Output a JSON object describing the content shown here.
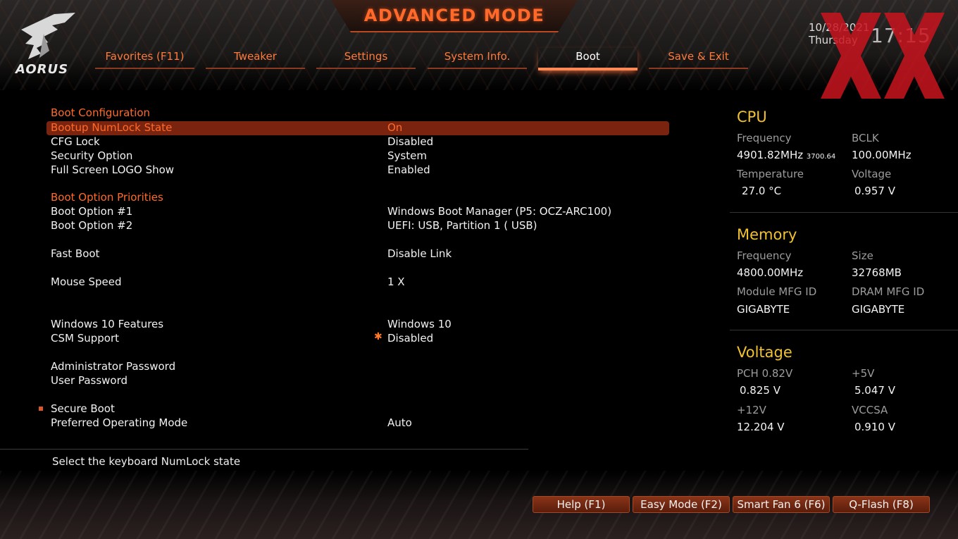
{
  "header": {
    "title": "ADVANCED MODE",
    "logo_text": "AORUS",
    "date": "10/28/2021",
    "weekday": "Thursday",
    "time": "17:15"
  },
  "tabs": [
    {
      "label": "Favorites (F11)",
      "active": false
    },
    {
      "label": "Tweaker",
      "active": false
    },
    {
      "label": "Settings",
      "active": false
    },
    {
      "label": "System Info.",
      "active": false
    },
    {
      "label": "Boot",
      "active": true
    },
    {
      "label": "Save & Exit",
      "active": false
    }
  ],
  "settings": {
    "boot_config_header": "Boot Configuration",
    "numlock": {
      "label": "Bootup NumLock State",
      "value": "On"
    },
    "cfg_lock": {
      "label": "CFG Lock",
      "value": "Disabled"
    },
    "security_option": {
      "label": "Security Option",
      "value": "System"
    },
    "logo_show": {
      "label": "Full Screen LOGO Show",
      "value": "Enabled"
    },
    "priorities_header": "Boot Option Priorities",
    "boot_option_1": {
      "label": "Boot Option #1",
      "value": "Windows Boot Manager (P5: OCZ-ARC100)"
    },
    "boot_option_2": {
      "label": "Boot Option #2",
      "value": "UEFI:  USB, Partition 1 ( USB)"
    },
    "fast_boot": {
      "label": "Fast Boot",
      "value": "Disable Link"
    },
    "mouse_speed": {
      "label": "Mouse Speed",
      "value": "1 X"
    },
    "win10_features": {
      "label": "Windows 10 Features",
      "value": "Windows 10"
    },
    "csm_support": {
      "label": "CSM Support",
      "value": "Disabled"
    },
    "admin_password": {
      "label": "Administrator Password"
    },
    "user_password": {
      "label": "User Password"
    },
    "secure_boot": {
      "label": "Secure Boot"
    },
    "preferred_os_mode": {
      "label": "Preferred Operating Mode",
      "value": "Auto"
    }
  },
  "help_text": "Select the keyboard NumLock state",
  "hardware": {
    "cpu": {
      "title": "CPU",
      "frequency_label": "Frequency",
      "frequency": "4901.82MHz",
      "frequency_sub": "3700.64",
      "bclk_label": "BCLK",
      "bclk": "100.00MHz",
      "temperature_label": "Temperature",
      "temperature": "27.0 °C",
      "voltage_label": "Voltage",
      "voltage": "0.957 V"
    },
    "memory": {
      "title": "Memory",
      "frequency_label": "Frequency",
      "frequency": "4800.00MHz",
      "size_label": "Size",
      "size": "32768MB",
      "module_mfg_label": "Module MFG ID",
      "module_mfg": "GIGABYTE",
      "dram_mfg_label": "DRAM MFG ID",
      "dram_mfg": "GIGABYTE"
    },
    "voltage": {
      "title": "Voltage",
      "pch_label": "PCH 0.82V",
      "pch": "0.825 V",
      "p5v_label": "+5V",
      "p5v": "5.047 V",
      "p12v_label": "+12V",
      "p12v": "12.204 V",
      "vccsa_label": "VCCSA",
      "vccsa": "0.910 V"
    }
  },
  "function_buttons": {
    "help": "Help (F1)",
    "easy_mode": "Easy Mode (F2)",
    "smart_fan": "Smart Fan 6 (F6)",
    "qflash": "Q-Flash (F8)"
  },
  "colors": {
    "accent_orange": "#ff6a2a",
    "selection_bg": "#7a2410",
    "section_yellow": "#f1c230",
    "watermark_red": "#c8141e"
  }
}
